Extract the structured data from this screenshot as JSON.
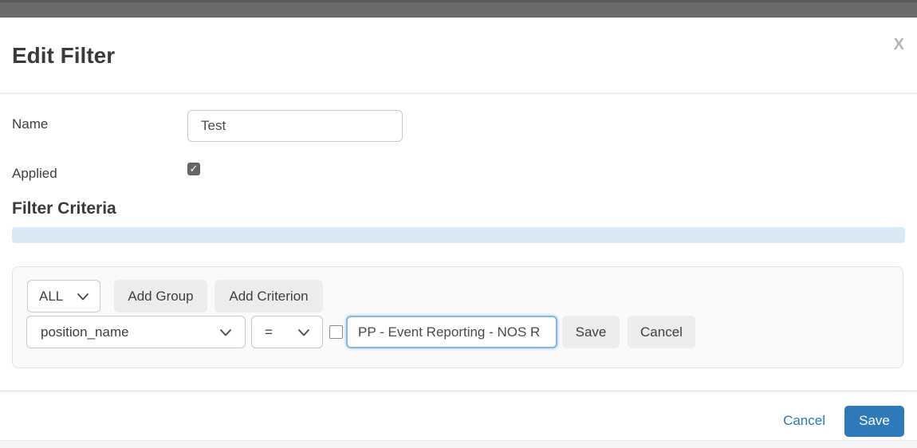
{
  "colors": {
    "topbar_gray": "#6a6a6a",
    "accent_blue": "#2e79b9",
    "link_blue": "#2779ba",
    "focus_border_blue": "#82b6e6",
    "info_bar_blue": "#d9eaf5",
    "panel_bg": "#fafafa",
    "button_gray": "#ececec"
  },
  "icons": {
    "close": "X",
    "check": "✓"
  },
  "dialog": {
    "title": "Edit Filter",
    "name": {
      "label": "Name",
      "value": "Test"
    },
    "applied": {
      "label": "Applied",
      "checked": true
    },
    "criteria": {
      "heading": "Filter Criteria",
      "group_operator": {
        "value": "ALL"
      },
      "add_group_label": "Add Group",
      "add_criterion_label": "Add Criterion",
      "criterion": {
        "field": {
          "value": "position_name"
        },
        "operator": {
          "value": "="
        },
        "checkbox_checked": false,
        "value_input": {
          "value": "PP - Event Reporting - NOS R"
        },
        "save_label": "Save",
        "cancel_label": "Cancel"
      }
    },
    "footer": {
      "cancel_label": "Cancel",
      "save_label": "Save"
    }
  }
}
